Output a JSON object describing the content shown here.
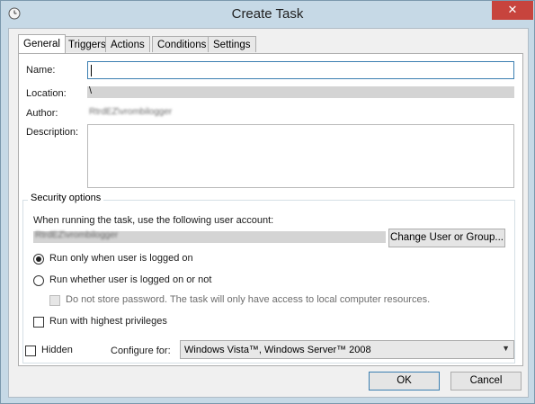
{
  "window": {
    "title": "Create Task",
    "close_glyph": "✕"
  },
  "tabs": [
    {
      "label": "General",
      "active": true
    },
    {
      "label": "Triggers",
      "active": false
    },
    {
      "label": "Actions",
      "active": false
    },
    {
      "label": "Conditions",
      "active": false
    },
    {
      "label": "Settings",
      "active": false
    }
  ],
  "general": {
    "name_label": "Name:",
    "name_value": "",
    "location_label": "Location:",
    "location_value": "\\",
    "author_label": "Author:",
    "author_value": "RtrdEZ\\vrombilogger",
    "description_label": "Description:",
    "description_value": ""
  },
  "security": {
    "legend": "Security options",
    "user_account_label": "When running the task, use the following user account:",
    "user_account_value": "RtrdEZ\\vrombilogger",
    "change_user_button": "Change User or Group...",
    "run_logged_on_label": "Run only when user is logged on",
    "run_logged_on_selected": true,
    "run_whether_label": "Run whether user is logged on or not",
    "run_whether_selected": false,
    "no_store_password_label": "Do not store password.  The task will only have access to local computer resources.",
    "no_store_password_checked": false,
    "highest_privileges_label": "Run with highest privileges",
    "highest_privileges_checked": false
  },
  "footer": {
    "hidden_label": "Hidden",
    "hidden_checked": false,
    "configure_for_label": "Configure for:",
    "configure_for_value": "Windows Vista™, Windows Server™ 2008",
    "ok_button": "OK",
    "cancel_button": "Cancel"
  },
  "colors": {
    "close_button": "#c7443d",
    "focus_border": "#3c7fb1",
    "chrome": "#c6d9e6"
  }
}
